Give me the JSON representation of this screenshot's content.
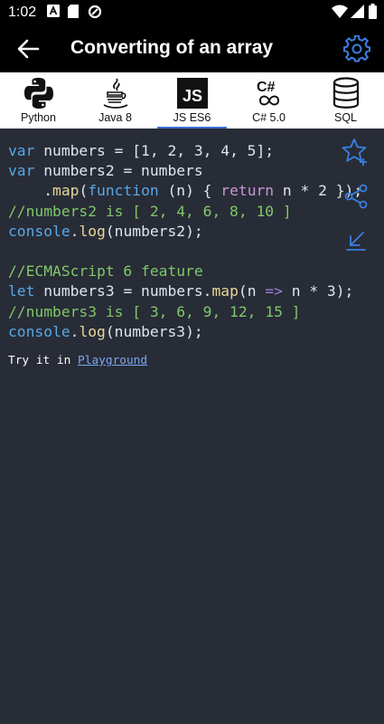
{
  "status_bar": {
    "time": "1:02",
    "icons": [
      "notification-a-icon",
      "sd-card-icon",
      "data-saver-icon",
      "wifi-icon",
      "signal-icon",
      "battery-icon"
    ]
  },
  "app_bar": {
    "title": "Converting of an array",
    "icons": [
      "back-arrow-icon",
      "gear-icon"
    ]
  },
  "tabs": [
    {
      "label": "Python",
      "icon": "python-icon",
      "active": false
    },
    {
      "label": "Java 8",
      "icon": "java-icon",
      "active": false
    },
    {
      "label": "JS ES6",
      "icon": "js-icon",
      "active": true
    },
    {
      "label": "C# 5.0",
      "icon": "csharp-icon",
      "active": false
    },
    {
      "label": "SQL",
      "icon": "database-icon",
      "active": false
    }
  ],
  "code": {
    "l1_kw": "var",
    "l1_rest": " numbers = [1, 2, 3, 4, 5];",
    "l2_kw": "var",
    "l2_rest": " numbers2 = numbers",
    "l3_indent": "    .",
    "l3_map": "map",
    "l3_paren": "(",
    "l3_function": "function",
    "l3_args": " (n) { ",
    "l3_return": "return",
    "l3_tail": " n * 2 });",
    "l4_comment": "//numbers2 is [ 2, 4, 6, 8, 10 ]",
    "l5_console": "console",
    "l5_dot": ".",
    "l5_log": "log",
    "l5_rest": "(numbers2);",
    "l7_comment": "//ECMAScript 6 feature",
    "l8_let": "let",
    "l8_mid": " numbers3 = numbers.",
    "l8_map": "map",
    "l8_args": "(n ",
    "l8_arrow": "=>",
    "l8_tail": " n * 3);",
    "l9_comment": "//numbers3 is [ 3, 6, 9, 12, 15 ]",
    "l10_console": "console",
    "l10_dot": ".",
    "l10_log": "log",
    "l10_rest": "(numbers3);"
  },
  "try_it": {
    "prefix": "Try it in ",
    "link": "Playground"
  },
  "side_actions": [
    "star-add-icon",
    "share-icon",
    "collapse-icon"
  ],
  "colors": {
    "background": "#282c36",
    "bar": "#000000",
    "accent": "#3b6fd8",
    "keyword": "#57a8e8",
    "comment": "#7fc86b",
    "return": "#c798d8",
    "method": "#e6d79a"
  }
}
